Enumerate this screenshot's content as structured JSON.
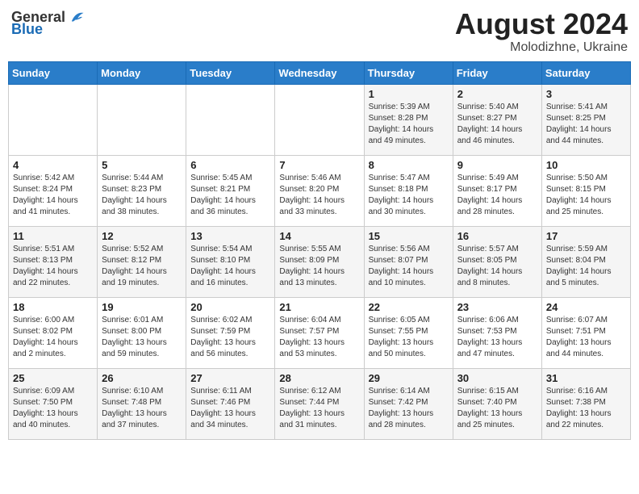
{
  "header": {
    "logo_general": "General",
    "logo_blue": "Blue",
    "month_year": "August 2024",
    "location": "Molodizhne, Ukraine"
  },
  "calendar": {
    "days_of_week": [
      "Sunday",
      "Monday",
      "Tuesday",
      "Wednesday",
      "Thursday",
      "Friday",
      "Saturday"
    ],
    "weeks": [
      [
        {
          "day": "",
          "info": ""
        },
        {
          "day": "",
          "info": ""
        },
        {
          "day": "",
          "info": ""
        },
        {
          "day": "",
          "info": ""
        },
        {
          "day": "1",
          "info": "Sunrise: 5:39 AM\nSunset: 8:28 PM\nDaylight: 14 hours\nand 49 minutes."
        },
        {
          "day": "2",
          "info": "Sunrise: 5:40 AM\nSunset: 8:27 PM\nDaylight: 14 hours\nand 46 minutes."
        },
        {
          "day": "3",
          "info": "Sunrise: 5:41 AM\nSunset: 8:25 PM\nDaylight: 14 hours\nand 44 minutes."
        }
      ],
      [
        {
          "day": "4",
          "info": "Sunrise: 5:42 AM\nSunset: 8:24 PM\nDaylight: 14 hours\nand 41 minutes."
        },
        {
          "day": "5",
          "info": "Sunrise: 5:44 AM\nSunset: 8:23 PM\nDaylight: 14 hours\nand 38 minutes."
        },
        {
          "day": "6",
          "info": "Sunrise: 5:45 AM\nSunset: 8:21 PM\nDaylight: 14 hours\nand 36 minutes."
        },
        {
          "day": "7",
          "info": "Sunrise: 5:46 AM\nSunset: 8:20 PM\nDaylight: 14 hours\nand 33 minutes."
        },
        {
          "day": "8",
          "info": "Sunrise: 5:47 AM\nSunset: 8:18 PM\nDaylight: 14 hours\nand 30 minutes."
        },
        {
          "day": "9",
          "info": "Sunrise: 5:49 AM\nSunset: 8:17 PM\nDaylight: 14 hours\nand 28 minutes."
        },
        {
          "day": "10",
          "info": "Sunrise: 5:50 AM\nSunset: 8:15 PM\nDaylight: 14 hours\nand 25 minutes."
        }
      ],
      [
        {
          "day": "11",
          "info": "Sunrise: 5:51 AM\nSunset: 8:13 PM\nDaylight: 14 hours\nand 22 minutes."
        },
        {
          "day": "12",
          "info": "Sunrise: 5:52 AM\nSunset: 8:12 PM\nDaylight: 14 hours\nand 19 minutes."
        },
        {
          "day": "13",
          "info": "Sunrise: 5:54 AM\nSunset: 8:10 PM\nDaylight: 14 hours\nand 16 minutes."
        },
        {
          "day": "14",
          "info": "Sunrise: 5:55 AM\nSunset: 8:09 PM\nDaylight: 14 hours\nand 13 minutes."
        },
        {
          "day": "15",
          "info": "Sunrise: 5:56 AM\nSunset: 8:07 PM\nDaylight: 14 hours\nand 10 minutes."
        },
        {
          "day": "16",
          "info": "Sunrise: 5:57 AM\nSunset: 8:05 PM\nDaylight: 14 hours\nand 8 minutes."
        },
        {
          "day": "17",
          "info": "Sunrise: 5:59 AM\nSunset: 8:04 PM\nDaylight: 14 hours\nand 5 minutes."
        }
      ],
      [
        {
          "day": "18",
          "info": "Sunrise: 6:00 AM\nSunset: 8:02 PM\nDaylight: 14 hours\nand 2 minutes."
        },
        {
          "day": "19",
          "info": "Sunrise: 6:01 AM\nSunset: 8:00 PM\nDaylight: 13 hours\nand 59 minutes."
        },
        {
          "day": "20",
          "info": "Sunrise: 6:02 AM\nSunset: 7:59 PM\nDaylight: 13 hours\nand 56 minutes."
        },
        {
          "day": "21",
          "info": "Sunrise: 6:04 AM\nSunset: 7:57 PM\nDaylight: 13 hours\nand 53 minutes."
        },
        {
          "day": "22",
          "info": "Sunrise: 6:05 AM\nSunset: 7:55 PM\nDaylight: 13 hours\nand 50 minutes."
        },
        {
          "day": "23",
          "info": "Sunrise: 6:06 AM\nSunset: 7:53 PM\nDaylight: 13 hours\nand 47 minutes."
        },
        {
          "day": "24",
          "info": "Sunrise: 6:07 AM\nSunset: 7:51 PM\nDaylight: 13 hours\nand 44 minutes."
        }
      ],
      [
        {
          "day": "25",
          "info": "Sunrise: 6:09 AM\nSunset: 7:50 PM\nDaylight: 13 hours\nand 40 minutes."
        },
        {
          "day": "26",
          "info": "Sunrise: 6:10 AM\nSunset: 7:48 PM\nDaylight: 13 hours\nand 37 minutes."
        },
        {
          "day": "27",
          "info": "Sunrise: 6:11 AM\nSunset: 7:46 PM\nDaylight: 13 hours\nand 34 minutes."
        },
        {
          "day": "28",
          "info": "Sunrise: 6:12 AM\nSunset: 7:44 PM\nDaylight: 13 hours\nand 31 minutes."
        },
        {
          "day": "29",
          "info": "Sunrise: 6:14 AM\nSunset: 7:42 PM\nDaylight: 13 hours\nand 28 minutes."
        },
        {
          "day": "30",
          "info": "Sunrise: 6:15 AM\nSunset: 7:40 PM\nDaylight: 13 hours\nand 25 minutes."
        },
        {
          "day": "31",
          "info": "Sunrise: 6:16 AM\nSunset: 7:38 PM\nDaylight: 13 hours\nand 22 minutes."
        }
      ]
    ]
  }
}
